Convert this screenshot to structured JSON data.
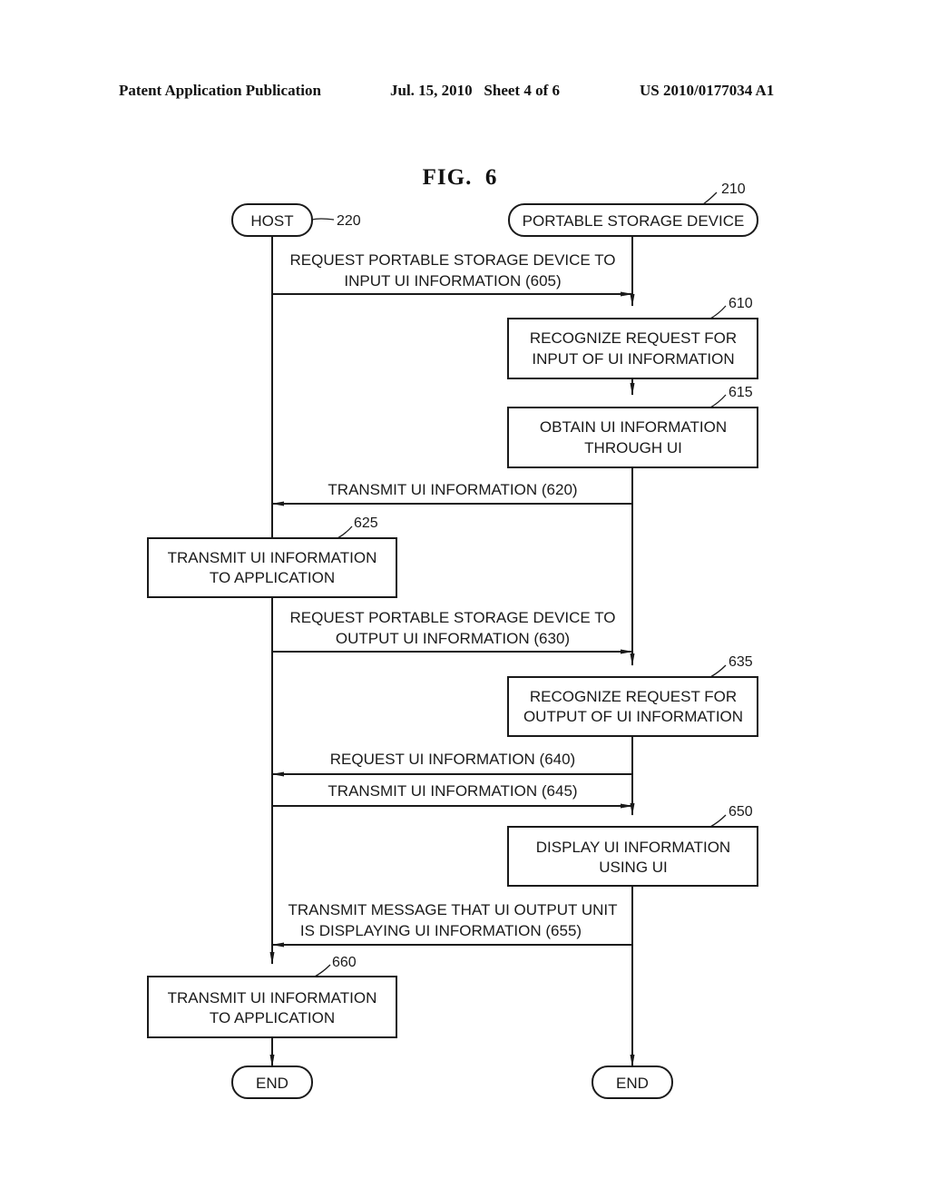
{
  "header": {
    "publication": "Patent Application Publication",
    "date_sheet": "Jul. 15, 2010   Sheet 4 of 6",
    "patent_number": "US 2010/0177034 A1"
  },
  "figure": {
    "title": "FIG.  6"
  },
  "actors": {
    "host": {
      "label": "HOST",
      "ref": "220"
    },
    "device": {
      "label": "PORTABLE STORAGE DEVICE",
      "ref": "210"
    }
  },
  "messages": {
    "m605": {
      "lines": [
        "REQUEST PORTABLE STORAGE DEVICE TO",
        "INPUT UI INFORMATION  (605)"
      ],
      "direction": "host-to-device"
    },
    "m620": {
      "lines": [
        "TRANSMIT UI INFORMATION (620)"
      ],
      "direction": "device-to-host"
    },
    "m630": {
      "lines": [
        "REQUEST PORTABLE STORAGE DEVICE TO",
        "OUTPUT UI INFORMATION  (630)"
      ],
      "direction": "host-to-device"
    },
    "m640": {
      "lines": [
        "REQUEST UI INFORMATION (640)"
      ],
      "direction": "device-to-host"
    },
    "m645": {
      "lines": [
        "TRANSMIT UI INFORMATION (645)"
      ],
      "direction": "host-to-device"
    },
    "m655": {
      "lines": [
        "TRANSMIT MESSAGE THAT UI OUTPUT UNIT",
        "IS DISPLAYING UI INFORMATION (655)"
      ],
      "direction": "device-to-host"
    }
  },
  "steps": {
    "s610": {
      "ref": "610",
      "lines": [
        "RECOGNIZE REQUEST FOR",
        "INPUT OF UI INFORMATION"
      ]
    },
    "s615": {
      "ref": "615",
      "lines": [
        "OBTAIN UI INFORMATION",
        "THROUGH UI"
      ]
    },
    "s625": {
      "ref": "625",
      "lines": [
        "TRANSMIT UI INFORMATION",
        "TO APPLICATION"
      ]
    },
    "s635": {
      "ref": "635",
      "lines": [
        "RECOGNIZE REQUEST FOR",
        "OUTPUT OF UI INFORMATION"
      ]
    },
    "s650": {
      "ref": "650",
      "lines": [
        "DISPLAY UI INFORMATION",
        "USING UI"
      ]
    },
    "s660": {
      "ref": "660",
      "lines": [
        "TRANSMIT UI INFORMATION",
        "TO APPLICATION"
      ]
    }
  },
  "terminals": {
    "host_end": "END",
    "device_end": "END"
  }
}
